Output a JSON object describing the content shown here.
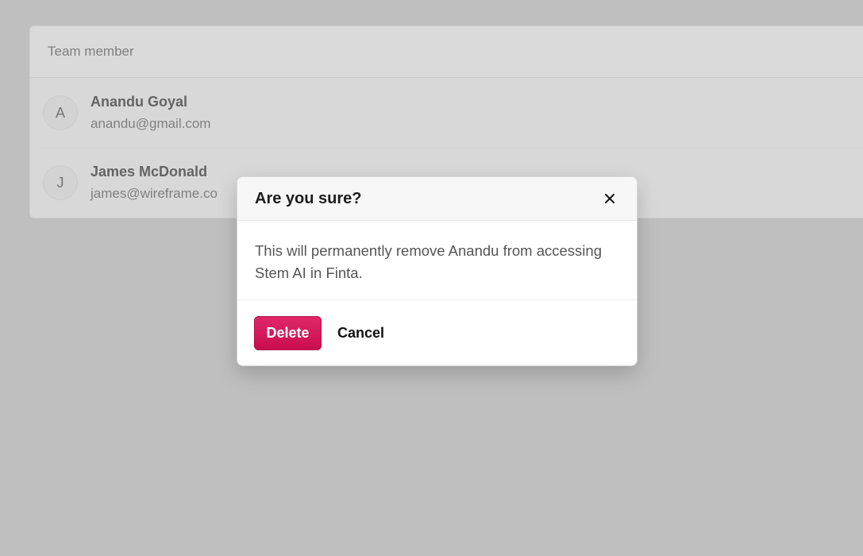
{
  "team_table": {
    "header": "Team member",
    "members": [
      {
        "initial": "A",
        "name": "Anandu Goyal",
        "email": "anandu@gmail.com"
      },
      {
        "initial": "J",
        "name": "James McDonald",
        "email": "james@wireframe.co"
      }
    ]
  },
  "modal": {
    "title": "Are you sure?",
    "close_icon": "close-icon",
    "message": "This will permanently remove Anandu from accessing Stem AI in Finta.",
    "delete_label": "Delete",
    "cancel_label": "Cancel"
  },
  "colors": {
    "delete_button": "#d4185a",
    "backdrop": "#d3d3d3"
  }
}
